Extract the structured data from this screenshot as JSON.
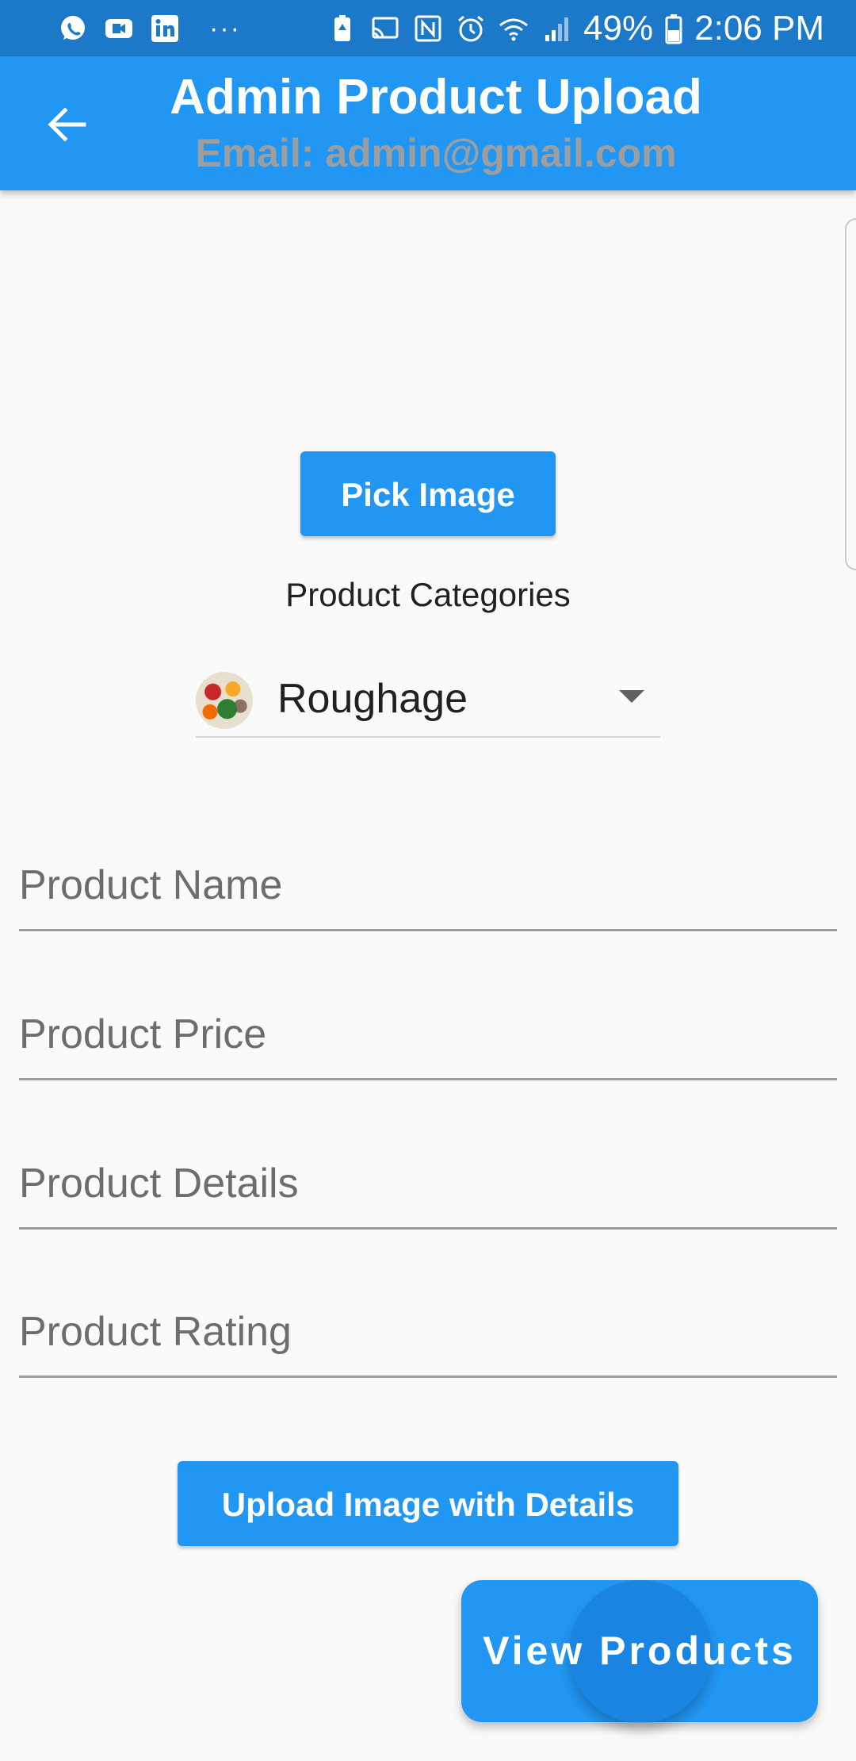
{
  "status_bar": {
    "left_icons": [
      "whatsapp-icon",
      "video-call-icon",
      "linkedin-icon"
    ],
    "more_dots": "···",
    "right_icons": [
      "battery-saver-icon",
      "cast-icon",
      "nfc-icon",
      "alarm-icon",
      "wifi-icon",
      "signal-icon"
    ],
    "battery_percent": "49%",
    "time": "2:06 PM"
  },
  "app_bar": {
    "title": "Admin Product Upload",
    "subtitle": "Email: admin@gmail.com",
    "back_icon": "arrow-back-icon"
  },
  "main": {
    "pick_image_label": "Pick Image",
    "categories_label": "Product Categories",
    "category_selected": "Roughage",
    "fields": [
      {
        "placeholder": "Product Name",
        "value": ""
      },
      {
        "placeholder": "Product Price",
        "value": ""
      },
      {
        "placeholder": "Product Details",
        "value": ""
      },
      {
        "placeholder": "Product Rating",
        "value": ""
      }
    ],
    "upload_label": "Upload Image with Details"
  },
  "fab": {
    "label": "View Products"
  },
  "colors": {
    "primary": "#2196f3",
    "status_bar": "#1c78c9",
    "subtitle": "#9e9e9e",
    "background": "#fafafa"
  }
}
